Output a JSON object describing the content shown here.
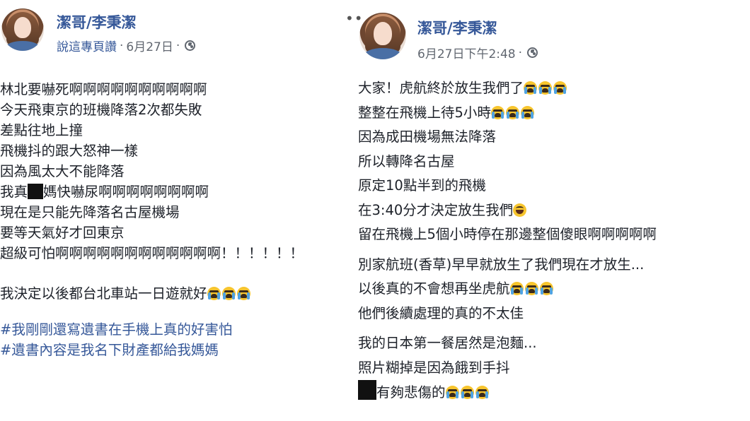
{
  "left_post": {
    "author": "潔哥/李秉潔",
    "meta_link": "說這專頁讚",
    "meta_sep": " · ",
    "meta_date": "6月27日",
    "lines": [
      "林北要嚇死啊啊啊啊啊啊啊啊啊啊",
      "今天飛東京的班機降落2次都失敗",
      "差點往地上撞",
      "飛機抖的跟大怒神一樣",
      "因為風太大不能降落",
      "我真",
      "媽快嚇尿啊啊啊啊啊啊啊啊",
      "現在是只能先降落名古屋機場",
      "要等天氣好才回東京",
      "超級可怕啊啊啊啊啊啊啊啊啊啊啊啊！！！！！！"
    ],
    "line_after_gap": "我決定以後都台北車站一日遊就好",
    "hashtags": [
      "#我剛剛還寫遺書在手機上真的好害怕",
      "#遺書內容是我名下財產都給我媽媽"
    ]
  },
  "right_post": {
    "more": "••",
    "author": "潔哥/李秉潔",
    "meta_date": "6月27日下午2:48",
    "meta_sep": " · ",
    "lines": [
      "大家！虎航終於放生我們了",
      "整整在飛機上待5小時",
      "因為成田機場無法降落",
      "所以轉降名古屋",
      "原定10點半到的飛機",
      "在3:40分才決定放生我們",
      "留在飛機上5個小時停在那邊整個傻眼啊啊啊啊啊"
    ],
    "para2": [
      "別家航班(香草)早早就放生了我們現在才放生...",
      "以後真的不會想再坐虎航",
      "他們後續處理的真的不太佳"
    ],
    "para3": [
      "我的日本第一餐居然是泡麵...",
      "照片糊掉是因為餓到手抖",
      "有夠悲傷的"
    ]
  },
  "icons": {
    "privacy": "globe-icon",
    "crying": "loudly-crying-face-icon",
    "laughing": "laughing-face-icon"
  },
  "colors": {
    "author": "#365899",
    "meta": "#616770",
    "hashtag": "#365899",
    "text": "#1d2129",
    "emoji": "#f7c52e"
  }
}
